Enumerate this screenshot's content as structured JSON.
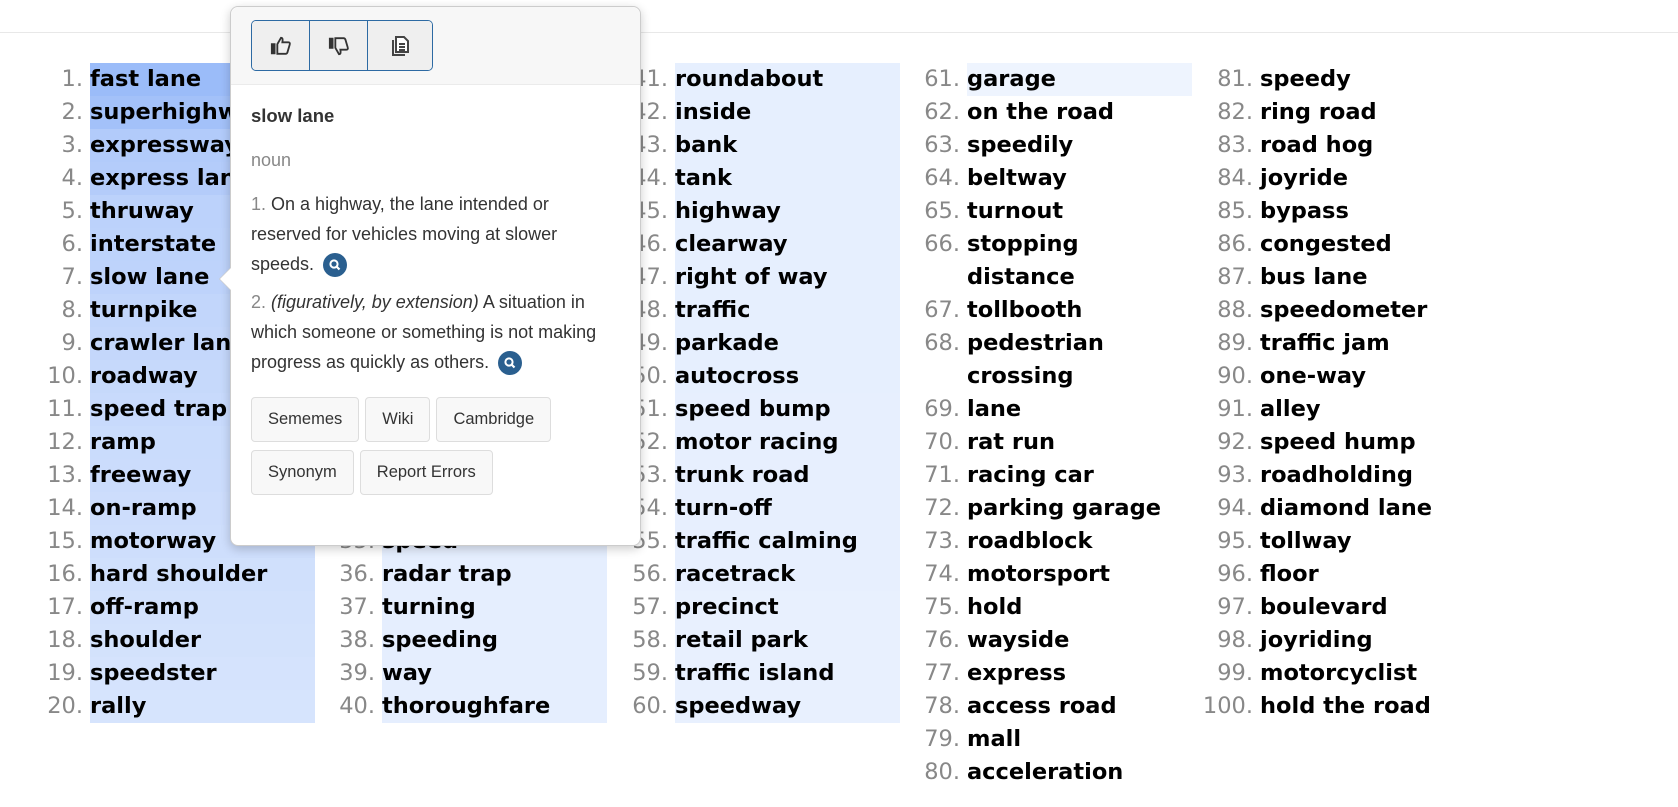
{
  "columns": [
    {
      "start": 1,
      "items": [
        {
          "rank": "1.",
          "word": "fast lane",
          "bg": "#9bbcf9"
        },
        {
          "rank": "2.",
          "word": "superhighway",
          "bg": "#a3c1f9"
        },
        {
          "rank": "3.",
          "word": "expressway",
          "bg": "#b2cbfa"
        },
        {
          "rank": "4.",
          "word": "express lane",
          "bg": "#b4ccfa"
        },
        {
          "rank": "5.",
          "word": "thruway",
          "bg": "#bcd2fb"
        },
        {
          "rank": "6.",
          "word": "interstate",
          "bg": "#bdd3fb"
        },
        {
          "rank": "7.",
          "word": "slow lane",
          "bg": "#bed3fb"
        },
        {
          "rank": "8.",
          "word": "turnpike",
          "bg": "#c2d6fb"
        },
        {
          "rank": "9.",
          "word": "crawler lane",
          "bg": "#c4d7fb"
        },
        {
          "rank": "10.",
          "word": "roadway",
          "bg": "#c6d9fb"
        },
        {
          "rank": "11.",
          "word": "speed trap",
          "bg": "#c8dafc"
        },
        {
          "rank": "12.",
          "word": "ramp",
          "bg": "#cadcfc"
        },
        {
          "rank": "13.",
          "word": "freeway",
          "bg": "#cbdcfc"
        },
        {
          "rank": "14.",
          "word": "on-ramp",
          "bg": "#cdddfc"
        },
        {
          "rank": "15.",
          "word": "motorway",
          "bg": "#cedefc"
        },
        {
          "rank": "16.",
          "word": "hard shoulder",
          "bg": "#d0e0fc"
        },
        {
          "rank": "17.",
          "word": "off-ramp",
          "bg": "#d2e1fc"
        },
        {
          "rank": "18.",
          "word": "shoulder",
          "bg": "#d3e2fc"
        },
        {
          "rank": "19.",
          "word": "speedster",
          "bg": "#d5e3fd"
        },
        {
          "rank": "20.",
          "word": "rally",
          "bg": "#d6e4fd"
        }
      ]
    },
    {
      "start": 15,
      "items": [
        {
          "rank": "35.",
          "word": "speed",
          "bg": "#e5eefe"
        },
        {
          "rank": "36.",
          "word": "radar trap",
          "bg": "#e5eefe"
        },
        {
          "rank": "37.",
          "word": "turning",
          "bg": "#e5eefe"
        },
        {
          "rank": "38.",
          "word": "speeding",
          "bg": "#e5eefe"
        },
        {
          "rank": "39.",
          "word": "way",
          "bg": "#e5eefe"
        },
        {
          "rank": "40.",
          "word": "thoroughfare",
          "bg": "#e5eefe"
        }
      ]
    },
    {
      "start": 1,
      "items": [
        {
          "rank": "41.",
          "word": "roundabout",
          "bg": "#e6effe"
        },
        {
          "rank": "42.",
          "word": "inside",
          "bg": "#e6effe"
        },
        {
          "rank": "43.",
          "word": "bank",
          "bg": "#e6effe"
        },
        {
          "rank": "44.",
          "word": "tank",
          "bg": "#e6effe"
        },
        {
          "rank": "45.",
          "word": "highway",
          "bg": "#e6effe"
        },
        {
          "rank": "46.",
          "word": "clearway",
          "bg": "#e6effe"
        },
        {
          "rank": "47.",
          "word": "right of way",
          "bg": "#e6effe"
        },
        {
          "rank": "48.",
          "word": "traffic",
          "bg": "#e6effe"
        },
        {
          "rank": "49.",
          "word": "parkade",
          "bg": "#e6effe"
        },
        {
          "rank": "50.",
          "word": "autocross",
          "bg": "#e6effe"
        },
        {
          "rank": "51.",
          "word": "speed bump",
          "bg": "#e7effe"
        },
        {
          "rank": "52.",
          "word": "motor racing",
          "bg": "#e7effe"
        },
        {
          "rank": "53.",
          "word": "trunk road",
          "bg": "#e7effe"
        },
        {
          "rank": "54.",
          "word": "turn-off",
          "bg": "#e7effe"
        },
        {
          "rank": "55.",
          "word": "traffic calming",
          "bg": "#e7effe"
        },
        {
          "rank": "56.",
          "word": "racetrack",
          "bg": "#e7effe"
        },
        {
          "rank": "57.",
          "word": "precinct",
          "bg": "#e8f0fe"
        },
        {
          "rank": "58.",
          "word": "retail park",
          "bg": "#e8f0fe"
        },
        {
          "rank": "59.",
          "word": "traffic island",
          "bg": "#e8f0fe"
        },
        {
          "rank": "60.",
          "word": "speedway",
          "bg": "#e8f0fe"
        }
      ]
    },
    {
      "start": 1,
      "items": [
        {
          "rank": "61.",
          "word": "garage",
          "bg": "#eef4fe"
        },
        {
          "rank": "62.",
          "word": "on the road"
        },
        {
          "rank": "63.",
          "word": "speedily"
        },
        {
          "rank": "64.",
          "word": "beltway"
        },
        {
          "rank": "65.",
          "word": "turnout"
        },
        {
          "rank": "66.",
          "word": "stopping distance"
        },
        {
          "rank": "67.",
          "word": "tollbooth"
        },
        {
          "rank": "68.",
          "word": "pedestrian crossing"
        },
        {
          "rank": "69.",
          "word": "lane"
        },
        {
          "rank": "70.",
          "word": "rat run"
        },
        {
          "rank": "71.",
          "word": "racing car"
        },
        {
          "rank": "72.",
          "word": "parking garage"
        },
        {
          "rank": "73.",
          "word": "roadblock"
        },
        {
          "rank": "74.",
          "word": "motorsport"
        },
        {
          "rank": "75.",
          "word": "hold"
        },
        {
          "rank": "76.",
          "word": "wayside"
        },
        {
          "rank": "77.",
          "word": "express"
        },
        {
          "rank": "78.",
          "word": "access road"
        },
        {
          "rank": "79.",
          "word": "mall"
        },
        {
          "rank": "80.",
          "word": "acceleration"
        }
      ]
    },
    {
      "start": 1,
      "items": [
        {
          "rank": "81.",
          "word": "speedy"
        },
        {
          "rank": "82.",
          "word": "ring road"
        },
        {
          "rank": "83.",
          "word": "road hog"
        },
        {
          "rank": "84.",
          "word": "joyride"
        },
        {
          "rank": "85.",
          "word": "bypass"
        },
        {
          "rank": "86.",
          "word": "congested"
        },
        {
          "rank": "87.",
          "word": "bus lane"
        },
        {
          "rank": "88.",
          "word": "speedometer"
        },
        {
          "rank": "89.",
          "word": "traffic jam"
        },
        {
          "rank": "90.",
          "word": "one-way"
        },
        {
          "rank": "91.",
          "word": "alley"
        },
        {
          "rank": "92.",
          "word": "speed hump"
        },
        {
          "rank": "93.",
          "word": "roadholding"
        },
        {
          "rank": "94.",
          "word": "diamond lane"
        },
        {
          "rank": "95.",
          "word": "tollway"
        },
        {
          "rank": "96.",
          "word": "floor"
        },
        {
          "rank": "97.",
          "word": "boulevard"
        },
        {
          "rank": "98.",
          "word": "joyriding"
        },
        {
          "rank": "99.",
          "word": "motorcyclist"
        },
        {
          "rank": "100.",
          "word": "hold the road"
        }
      ]
    }
  ],
  "popup": {
    "toolbar": {
      "icons": [
        "thumbs-up-icon",
        "thumbs-down-icon",
        "copy-icon"
      ]
    },
    "title": "slow lane",
    "pos": "noun",
    "definitions": [
      {
        "num": "1.",
        "qualifier": "",
        "text": "On a highway, the lane intended or reserved for vehicles moving at slower speeds."
      },
      {
        "num": "2.",
        "qualifier": "(figuratively, by extension)",
        "text": "A situation in which someone or something is not making progress as quickly as others."
      }
    ],
    "links": [
      "Sememes",
      "Wiki",
      "Cambridge",
      "Synonym",
      "Report Errors"
    ],
    "accent": "#2a5f8f"
  }
}
